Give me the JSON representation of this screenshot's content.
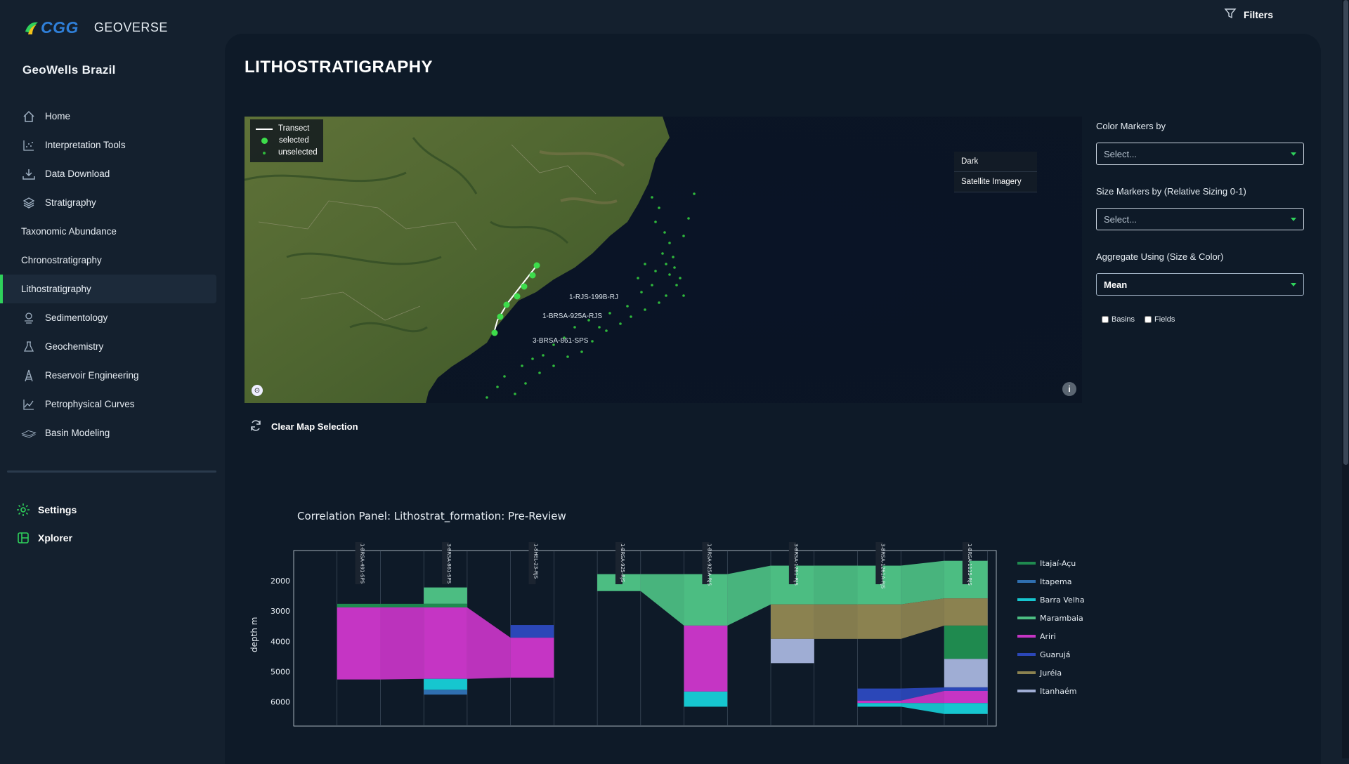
{
  "brand": {
    "logo_text": "CGG",
    "product": "GEOVERSE",
    "app_title": "GeoWells Brazil"
  },
  "topbar": {
    "filters_label": "Filters"
  },
  "nav": {
    "items": [
      {
        "label": "Home",
        "icon": "home-icon"
      },
      {
        "label": "Interpretation Tools",
        "icon": "chart-tools-icon"
      },
      {
        "label": "Data Download",
        "icon": "download-icon"
      },
      {
        "label": "Stratigraphy",
        "icon": "layers-icon"
      },
      {
        "label": "Taxonomic Abundance",
        "icon": ""
      },
      {
        "label": "Chronostratigraphy",
        "icon": ""
      },
      {
        "label": "Lithostratigraphy",
        "icon": "",
        "active": true
      },
      {
        "label": "Sedimentology",
        "icon": "sediment-icon"
      },
      {
        "label": "Geochemistry",
        "icon": "flask-icon"
      },
      {
        "label": "Reservoir Engineering",
        "icon": "rig-icon"
      },
      {
        "label": "Petrophysical Curves",
        "icon": "curves-icon"
      },
      {
        "label": "Basin Modeling",
        "icon": "basin-icon"
      }
    ],
    "settings_label": "Settings",
    "xplorer_label": "Xplorer"
  },
  "page": {
    "title": "LITHOSTRATIGRAPHY"
  },
  "map": {
    "legend": {
      "transect": "Transect",
      "selected": "selected",
      "unselected": "unselected"
    },
    "layers": [
      "Dark",
      "Satellite Imagery"
    ],
    "well_labels": [
      "1-RJS-199B-RJ",
      "1-BRSA-925A-RJS",
      "3-BRSA-861-SPS"
    ],
    "info_symbol": "i"
  },
  "controls": {
    "color_markers_label": "Color Markers by",
    "color_markers_value": "Select...",
    "size_markers_label": "Size Markers by (Relative Sizing 0-1)",
    "size_markers_value": "Select...",
    "aggregate_label": "Aggregate Using (Size & Color)",
    "aggregate_value": "Mean",
    "basins_label": "Basins",
    "fields_label": "Fields"
  },
  "clear_map_label": "Clear Map Selection",
  "chart_data": {
    "type": "area",
    "title": "Correlation Panel: Lithostrat_formation: Pre-Review",
    "ylabel": "depth m",
    "ylim": [
      1000,
      6800
    ],
    "yticks": [
      2000,
      3000,
      4000,
      5000,
      6000
    ],
    "y_reversed": true,
    "wells": [
      "1-BRSA-491-SPS",
      "3-BRSA-861-SPS",
      "1-SHEL-23-RJS",
      "1-BRSA-925-RJS",
      "1-BRSA-925A-RJS",
      "3-BRSA-1261-RJS",
      "3-BRSA-1261A-RJS",
      "1-BRSA-1115-RJS"
    ],
    "legend": [
      {
        "name": "Itajaí-Açu",
        "color": "#1f8a4f"
      },
      {
        "name": "Itapema",
        "color": "#2f6fb0"
      },
      {
        "name": "Barra Velha",
        "color": "#16c6cf"
      },
      {
        "name": "Marambaia",
        "color": "#4cbd82"
      },
      {
        "name": "Ariri",
        "color": "#c535c4"
      },
      {
        "name": "Guarujá",
        "color": "#2b47b8"
      },
      {
        "name": "Juréia",
        "color": "#8b8250"
      },
      {
        "name": "Itanhaém",
        "color": "#9fadd4"
      }
    ],
    "intervals": [
      {
        "well": "1-BRSA-491-SPS",
        "formation": "Itajaí-Açu",
        "top": 2760,
        "base": 2880
      },
      {
        "well": "1-BRSA-491-SPS",
        "formation": "Ariri",
        "top": 2880,
        "base": 5260
      },
      {
        "well": "3-BRSA-861-SPS",
        "formation": "Marambaia",
        "top": 2220,
        "base": 2760
      },
      {
        "well": "3-BRSA-861-SPS",
        "formation": "Itajaí-Açu",
        "top": 2760,
        "base": 2880
      },
      {
        "well": "3-BRSA-861-SPS",
        "formation": "Ariri",
        "top": 2880,
        "base": 5240
      },
      {
        "well": "3-BRSA-861-SPS",
        "formation": "Barra Velha",
        "top": 5240,
        "base": 5600
      },
      {
        "well": "3-BRSA-861-SPS",
        "formation": "Itapema",
        "top": 5600,
        "base": 5760
      },
      {
        "well": "1-SHEL-23-RJS",
        "formation": "Guarujá",
        "top": 3460,
        "base": 3880
      },
      {
        "well": "1-SHEL-23-RJS",
        "formation": "Ariri",
        "top": 3880,
        "base": 5200
      },
      {
        "well": "1-BRSA-925-RJS",
        "formation": "Marambaia",
        "top": 1780,
        "base": 2340
      },
      {
        "well": "1-BRSA-925A-RJS",
        "formation": "Marambaia",
        "top": 1780,
        "base": 3480
      },
      {
        "well": "1-BRSA-925A-RJS",
        "formation": "Ariri",
        "top": 3480,
        "base": 5660
      },
      {
        "well": "1-BRSA-925A-RJS",
        "formation": "Barra Velha",
        "top": 5660,
        "base": 6160
      },
      {
        "well": "3-BRSA-1261-RJS",
        "formation": "Marambaia",
        "top": 1500,
        "base": 2780
      },
      {
        "well": "3-BRSA-1261-RJS",
        "formation": "Juréia",
        "top": 2780,
        "base": 3920
      },
      {
        "well": "3-BRSA-1261-RJS",
        "formation": "Itanhaém",
        "top": 3920,
        "base": 4720
      },
      {
        "well": "3-BRSA-1261A-RJS",
        "formation": "Marambaia",
        "top": 1500,
        "base": 2780
      },
      {
        "well": "3-BRSA-1261A-RJS",
        "formation": "Juréia",
        "top": 2780,
        "base": 3920
      },
      {
        "well": "3-BRSA-1261A-RJS",
        "formation": "Guarujá",
        "top": 5560,
        "base": 5960
      },
      {
        "well": "3-BRSA-1261A-RJS",
        "formation": "Ariri",
        "top": 5960,
        "base": 6040
      },
      {
        "well": "3-BRSA-1261A-RJS",
        "formation": "Barra Velha",
        "top": 6040,
        "base": 6160
      },
      {
        "well": "1-BRSA-1115-RJS",
        "formation": "Marambaia",
        "top": 1340,
        "base": 2580
      },
      {
        "well": "1-BRSA-1115-RJS",
        "formation": "Juréia",
        "top": 2580,
        "base": 3480
      },
      {
        "well": "1-BRSA-1115-RJS",
        "formation": "Itajaí-Açu",
        "top": 3480,
        "base": 4580
      },
      {
        "well": "1-BRSA-1115-RJS",
        "formation": "Itanhaém",
        "top": 4580,
        "base": 5520
      },
      {
        "well": "1-BRSA-1115-RJS",
        "formation": "Guarujá",
        "top": 5520,
        "base": 5640
      },
      {
        "well": "1-BRSA-1115-RJS",
        "formation": "Ariri",
        "top": 5640,
        "base": 6040
      },
      {
        "well": "1-BRSA-1115-RJS",
        "formation": "Barra Velha",
        "top": 6040,
        "base": 6400
      }
    ]
  }
}
